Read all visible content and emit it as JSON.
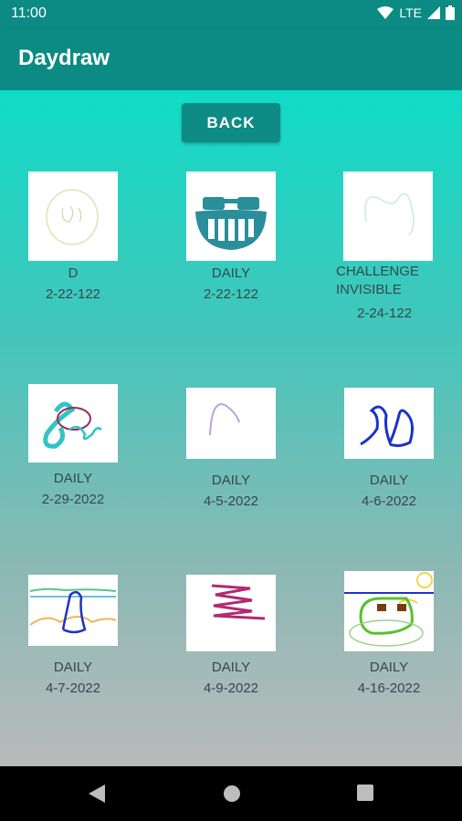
{
  "status": {
    "time": "11:00",
    "network": "LTE"
  },
  "app": {
    "title": "Daydraw"
  },
  "back_label": "BACK",
  "drawings": [
    {
      "title": "D",
      "date": "2-22-122"
    },
    {
      "title": "DAILY",
      "date": "2-22-122"
    },
    {
      "title": "CHALLENGE INVISIBLE",
      "date": "2-24-122"
    },
    {
      "title": "DAILY",
      "date": "2-29-2022"
    },
    {
      "title": "DAILY",
      "date": "4-5-2022"
    },
    {
      "title": "DAILY",
      "date": "4-6-2022"
    },
    {
      "title": "DAILY",
      "date": "4-7-2022"
    },
    {
      "title": "DAILY",
      "date": "4-9-2022"
    },
    {
      "title": "DAILY",
      "date": "4-16-2022"
    }
  ]
}
